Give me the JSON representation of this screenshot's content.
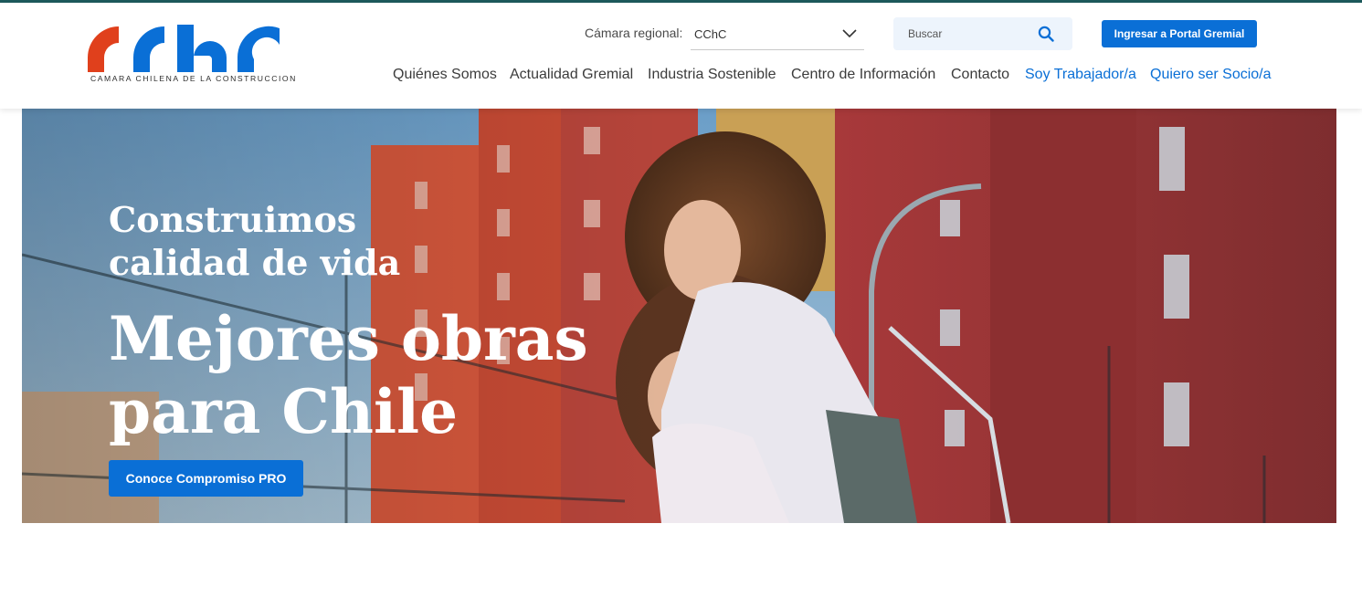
{
  "brand": {
    "logo_text": "CChC",
    "tagline": "CAMARA CHILENA DE LA CONSTRUCCION",
    "colors": {
      "orange": "#e0401c",
      "blue": "#0a6fd6"
    }
  },
  "region": {
    "label": "Cámara regional:",
    "selected": "CChC"
  },
  "search": {
    "placeholder": "Buscar"
  },
  "header": {
    "portal_button": "Ingresar a Portal Gremial"
  },
  "nav": {
    "items": [
      {
        "label": "Quiénes Somos"
      },
      {
        "label": "Actualidad Gremial"
      },
      {
        "label": "Industria Sostenible"
      },
      {
        "label": "Centro de Información"
      },
      {
        "label": "Contacto"
      },
      {
        "label": "Soy Trabajador/a"
      },
      {
        "label": "Quiero ser Socio/a"
      }
    ]
  },
  "hero": {
    "subtitle": "Construimos calidad de vida",
    "title": "Mejores obras para Chile",
    "cta": "Conoce Compromiso PRO"
  }
}
